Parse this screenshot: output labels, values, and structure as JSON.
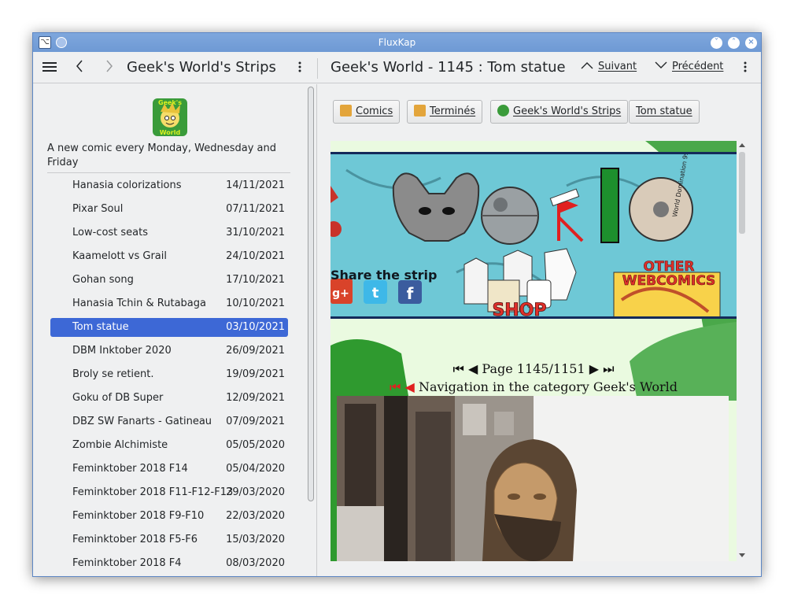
{
  "window": {
    "title": "FluxKap"
  },
  "toolbar": {
    "left_title": "Geek's World's Strips",
    "right_title": "Geek's World - 1145 : Tom statue",
    "next_label": "Suivant",
    "prev_label": "Précédent"
  },
  "sidebar": {
    "description": "A new comic every Monday, Wednesday and Friday",
    "logo_text_top": "Geek's",
    "logo_text_bottom": "World",
    "items": [
      {
        "label": "Hanasia colorizations",
        "date": "14/11/2021"
      },
      {
        "label": "Pixar Soul",
        "date": "07/11/2021"
      },
      {
        "label": "Low-cost seats",
        "date": "31/10/2021"
      },
      {
        "label": "Kaamelott vs Grail",
        "date": "24/10/2021"
      },
      {
        "label": "Gohan song",
        "date": "17/10/2021"
      },
      {
        "label": "Hanasia Tchin & Rutabaga",
        "date": "10/10/2021"
      },
      {
        "label": "Tom statue",
        "date": "03/10/2021"
      },
      {
        "label": "DBM Inktober 2020",
        "date": "26/09/2021"
      },
      {
        "label": "Broly se retient.",
        "date": "19/09/2021"
      },
      {
        "label": "Goku of DB Super",
        "date": "12/09/2021"
      },
      {
        "label": "DBZ SW Fanarts - Gatineau",
        "date": "07/09/2021"
      },
      {
        "label": "Zombie Alchimiste",
        "date": "05/05/2020"
      },
      {
        "label": "Feminktober 2018 F14",
        "date": "05/04/2020"
      },
      {
        "label": "Feminktober 2018 F11-F12-F13",
        "date": "29/03/2020"
      },
      {
        "label": "Feminktober 2018 F9-F10",
        "date": "22/03/2020"
      },
      {
        "label": "Feminktober 2018 F5-F6",
        "date": "15/03/2020"
      },
      {
        "label": "Feminktober 2018 F4",
        "date": "08/03/2020"
      }
    ],
    "selected_index": 6
  },
  "breadcrumbs": [
    {
      "label": "Comics",
      "icon": "rss-folder-icon"
    },
    {
      "label": "Terminés",
      "icon": "rss-folder-icon"
    },
    {
      "label": "Geek's World's Strips",
      "icon": "feed-icon"
    },
    {
      "label": "Tom statue",
      "icon": ""
    }
  ],
  "webpage": {
    "share_label": "Share the strip",
    "shop_label": "SHOP",
    "other_webcomics_line1": "OTHER",
    "other_webcomics_line2": "WEBCOMICS",
    "cd_label": "World Domination 99",
    "pager_text": "Page 1145/1151",
    "category_text": "Navigation in the category Geek's World"
  },
  "colors": {
    "selection": "#3d68d6",
    "titlebar": "#6e99d4",
    "banner": "#6ec8d6"
  }
}
